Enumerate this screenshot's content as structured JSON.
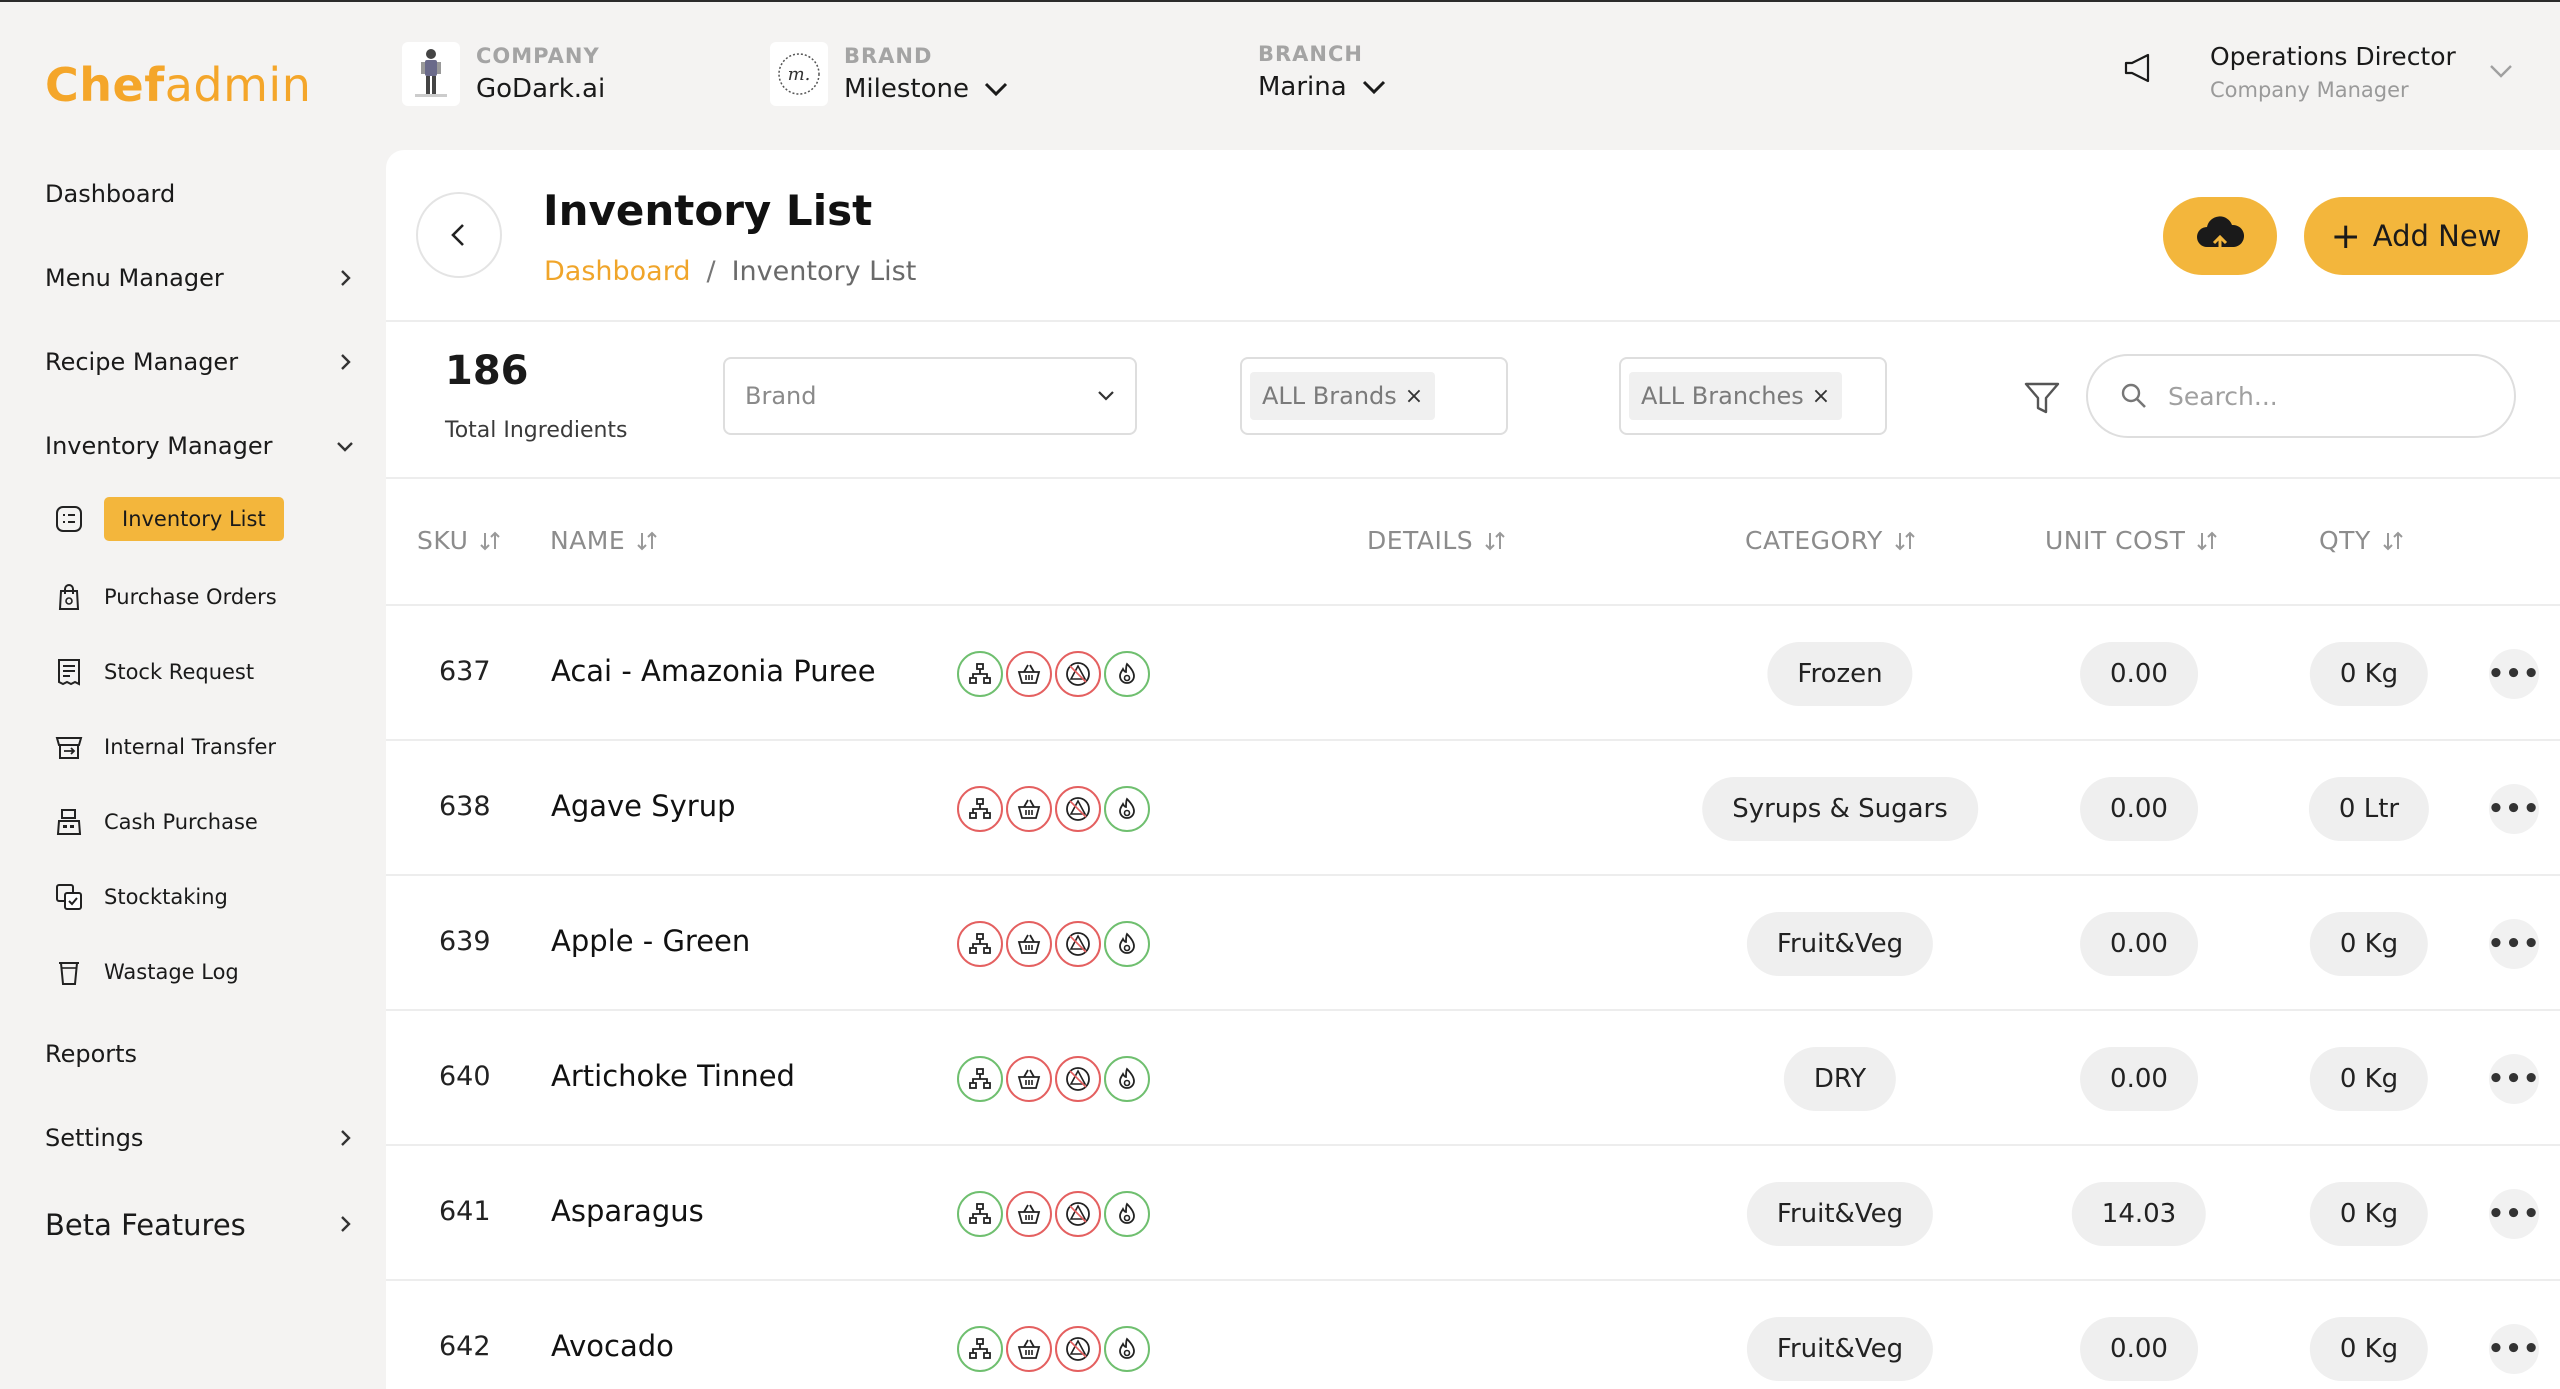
{
  "logo": {
    "part1": "Chef",
    "part2": "admin"
  },
  "header": {
    "company": {
      "caption": "COMPANY",
      "value": "GoDark.ai"
    },
    "brand": {
      "caption": "BRAND",
      "value": "Milestone"
    },
    "branch": {
      "caption": "BRANCH",
      "value": "Marina"
    },
    "user": {
      "name": "Operations Director",
      "role": "Company Manager"
    }
  },
  "sidebar": {
    "items": [
      {
        "label": "Dashboard"
      },
      {
        "label": "Menu Manager"
      },
      {
        "label": "Recipe Manager"
      },
      {
        "label": "Inventory Manager"
      },
      {
        "label": "Reports"
      },
      {
        "label": "Settings"
      },
      {
        "label": "Beta Features"
      }
    ],
    "inventory_sub": [
      {
        "label": "Inventory List",
        "icon": "list-icon"
      },
      {
        "label": "Purchase Orders",
        "icon": "shopping-bag-icon"
      },
      {
        "label": "Stock Request",
        "icon": "receipt-icon"
      },
      {
        "label": "Internal Transfer",
        "icon": "transfer-icon"
      },
      {
        "label": "Cash Purchase",
        "icon": "cash-register-icon"
      },
      {
        "label": "Stocktaking",
        "icon": "stocktake-icon"
      },
      {
        "label": "Wastage Log",
        "icon": "trash-bin-icon"
      }
    ]
  },
  "page": {
    "title": "Inventory List",
    "breadcrumb": {
      "link": "Dashboard",
      "separator": "/",
      "current": "Inventory List"
    },
    "add_new_label": "Add New",
    "add_new_plus": "+"
  },
  "summary": {
    "total": "186",
    "label": "Total Ingredients"
  },
  "filters": {
    "brand_placeholder": "Brand",
    "brands_tag": "ALL Brands",
    "branches_tag": "ALL Branches",
    "tag_remove": "×",
    "search_placeholder": "Search..."
  },
  "table": {
    "headers": {
      "sku": "SKU",
      "name": "NAME",
      "details": "DETAILS",
      "category": "CATEGORY",
      "unit_cost": "UNIT COST",
      "qty": "QTY"
    },
    "more_label": "•••",
    "rows": [
      {
        "sku": "637",
        "name": "Acai - Amazonia Puree",
        "category": "Frozen",
        "unit_cost": "0.00",
        "qty": "0 Kg",
        "details": [
          "green",
          "red",
          "red",
          "green"
        ]
      },
      {
        "sku": "638",
        "name": "Agave Syrup",
        "category": "Syrups & Sugars",
        "unit_cost": "0.00",
        "qty": "0 Ltr",
        "details": [
          "red",
          "red",
          "red",
          "green"
        ]
      },
      {
        "sku": "639",
        "name": "Apple - Green",
        "category": "Fruit&Veg",
        "unit_cost": "0.00",
        "qty": "0 Kg",
        "details": [
          "red",
          "red",
          "red",
          "green"
        ]
      },
      {
        "sku": "640",
        "name": "Artichoke Tinned",
        "category": "DRY",
        "unit_cost": "0.00",
        "qty": "0 Kg",
        "details": [
          "green",
          "red",
          "red",
          "green"
        ]
      },
      {
        "sku": "641",
        "name": "Asparagus",
        "category": "Fruit&Veg",
        "unit_cost": "14.03",
        "qty": "0 Kg",
        "details": [
          "green",
          "red",
          "red",
          "green"
        ]
      },
      {
        "sku": "642",
        "name": "Avocado",
        "category": "Fruit&Veg",
        "unit_cost": "0.00",
        "qty": "0 Kg",
        "details": [
          "green",
          "red",
          "red",
          "green"
        ]
      }
    ]
  },
  "colors": {
    "accent": "#f3b63c",
    "accent_text": "#f0a52a",
    "icon_green": "#6fbf6f",
    "icon_red": "#e46060"
  }
}
